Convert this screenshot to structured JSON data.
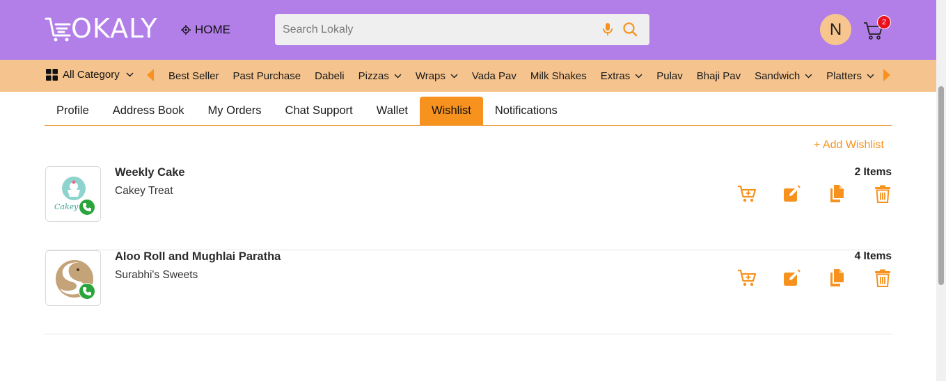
{
  "header": {
    "logo_text": "OKALY",
    "logo_alt": "LOKALY",
    "home_label": "HOME",
    "search_placeholder": "Search Lokaly",
    "avatar_initial": "N",
    "cart_count": "2",
    "bg_color": "#b27ee8"
  },
  "category_bar": {
    "all_category_label": "All Category",
    "items": [
      {
        "label": "Best Seller",
        "dropdown": false
      },
      {
        "label": "Past Purchase",
        "dropdown": false
      },
      {
        "label": "Dabeli",
        "dropdown": false
      },
      {
        "label": "Pizzas",
        "dropdown": true
      },
      {
        "label": "Wraps",
        "dropdown": true
      },
      {
        "label": "Vada Pav",
        "dropdown": false
      },
      {
        "label": "Milk Shakes",
        "dropdown": false
      },
      {
        "label": "Extras",
        "dropdown": true
      },
      {
        "label": "Pulav",
        "dropdown": false
      },
      {
        "label": "Bhaji Pav",
        "dropdown": false
      },
      {
        "label": "Sandwich",
        "dropdown": true
      },
      {
        "label": "Platters",
        "dropdown": true
      }
    ],
    "bg_color": "#f5c38d",
    "arrow_color": "#f7921e"
  },
  "tabs": [
    {
      "label": "Profile",
      "active": false
    },
    {
      "label": "Address Book",
      "active": false
    },
    {
      "label": "My Orders",
      "active": false
    },
    {
      "label": "Chat Support",
      "active": false
    },
    {
      "label": "Wallet",
      "active": false
    },
    {
      "label": "Wishlist",
      "active": true
    },
    {
      "label": "Notifications",
      "active": false
    }
  ],
  "wishlist": {
    "add_label": "+ Add Wishlist",
    "accent_color": "#f7921e",
    "rows": [
      {
        "title": "Weekly Cake",
        "store": "Cakey Treat",
        "count": "2 Items",
        "logo": "cakey-logo",
        "logo_text": "Cakey"
      },
      {
        "title": "Aloo Roll and Mughlai Paratha",
        "store": "Surabhi's Sweets",
        "count": "4 Items",
        "logo": "surabhi-logo"
      }
    ],
    "actions": [
      "add-to-cart-icon",
      "edit-icon",
      "copy-icon",
      "delete-icon"
    ]
  }
}
